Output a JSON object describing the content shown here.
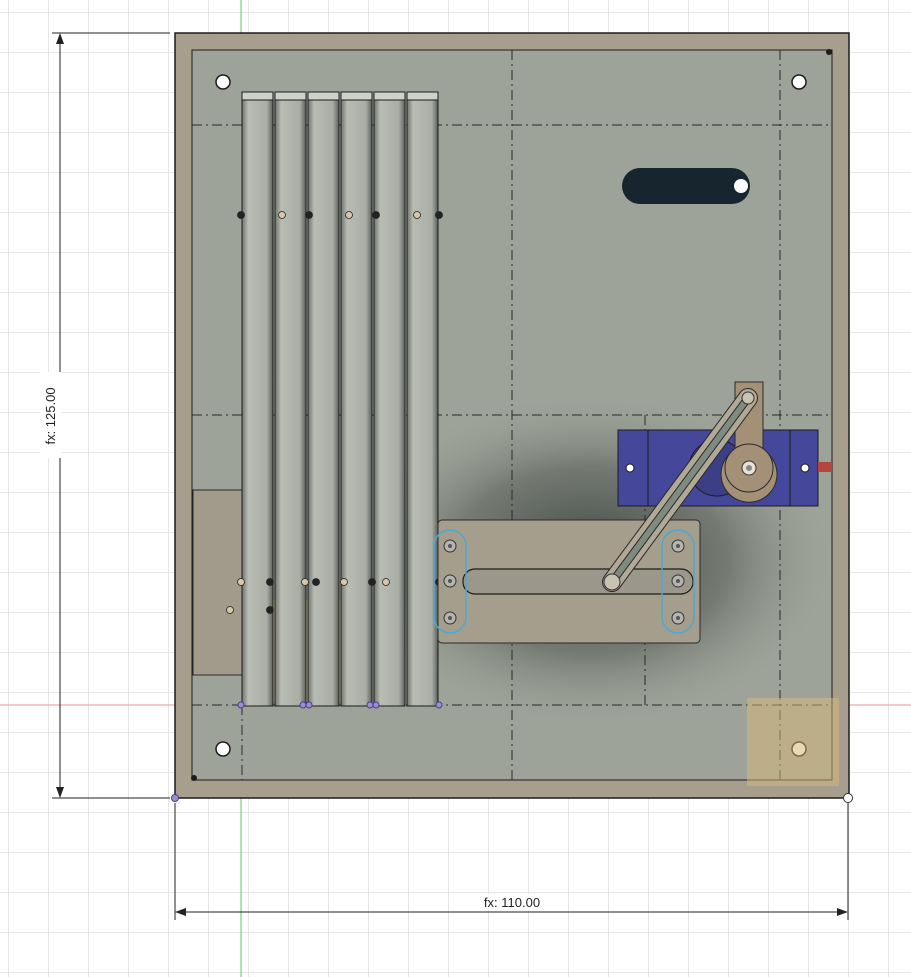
{
  "dimensions": {
    "height_label": "fx: 125.00",
    "width_label": "fx: 110.00"
  },
  "colors": {
    "plate": "#9ea399",
    "plate_border": "#a89e8e",
    "servo": "#45479a",
    "slot": "#17262e",
    "highlight": "#d8b97a",
    "sketch_dim": "#333333",
    "axis_green": "#78d17a",
    "axis_red": "#f1a8a8"
  },
  "parts": {
    "base_plate": "base-plate",
    "slat_stack": "slat-stack",
    "servo": "servo-motor",
    "servo_horn": "servo-horn",
    "linkage_arm": "linkage-arm",
    "slider_plate": "slider-plate"
  }
}
